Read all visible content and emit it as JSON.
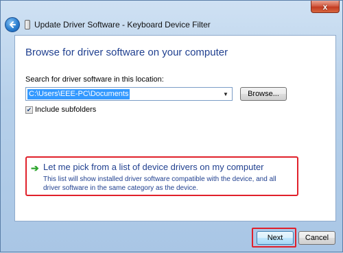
{
  "window": {
    "title": "Update Driver Software - Keyboard Device Filter",
    "close_label": "x"
  },
  "main": {
    "heading": "Browse for driver software on your computer",
    "search_label": "Search for driver software in this location:",
    "path_value": "C:\\Users\\EEE-PC\\Documents",
    "browse_label": "Browse...",
    "include_subfolders_label": "Include subfolders",
    "include_subfolders_checked": true,
    "pick_option": {
      "title": "Let me pick from a list of device drivers on my computer",
      "description": "This list will show installed driver software compatible with the device, and all driver software in the same category as the device."
    }
  },
  "footer": {
    "next_label": "Next",
    "cancel_label": "Cancel"
  },
  "icons": {
    "back": "back-arrow-icon",
    "device": "device-icon",
    "pick_arrow": "green-arrow-icon",
    "dropdown": "chevron-down-icon",
    "check": "checkmark-icon"
  },
  "colors": {
    "heading": "#1f3f8f",
    "highlight": "#e0202a",
    "arrow_green": "#2fa62f",
    "selection": "#3399ff"
  }
}
